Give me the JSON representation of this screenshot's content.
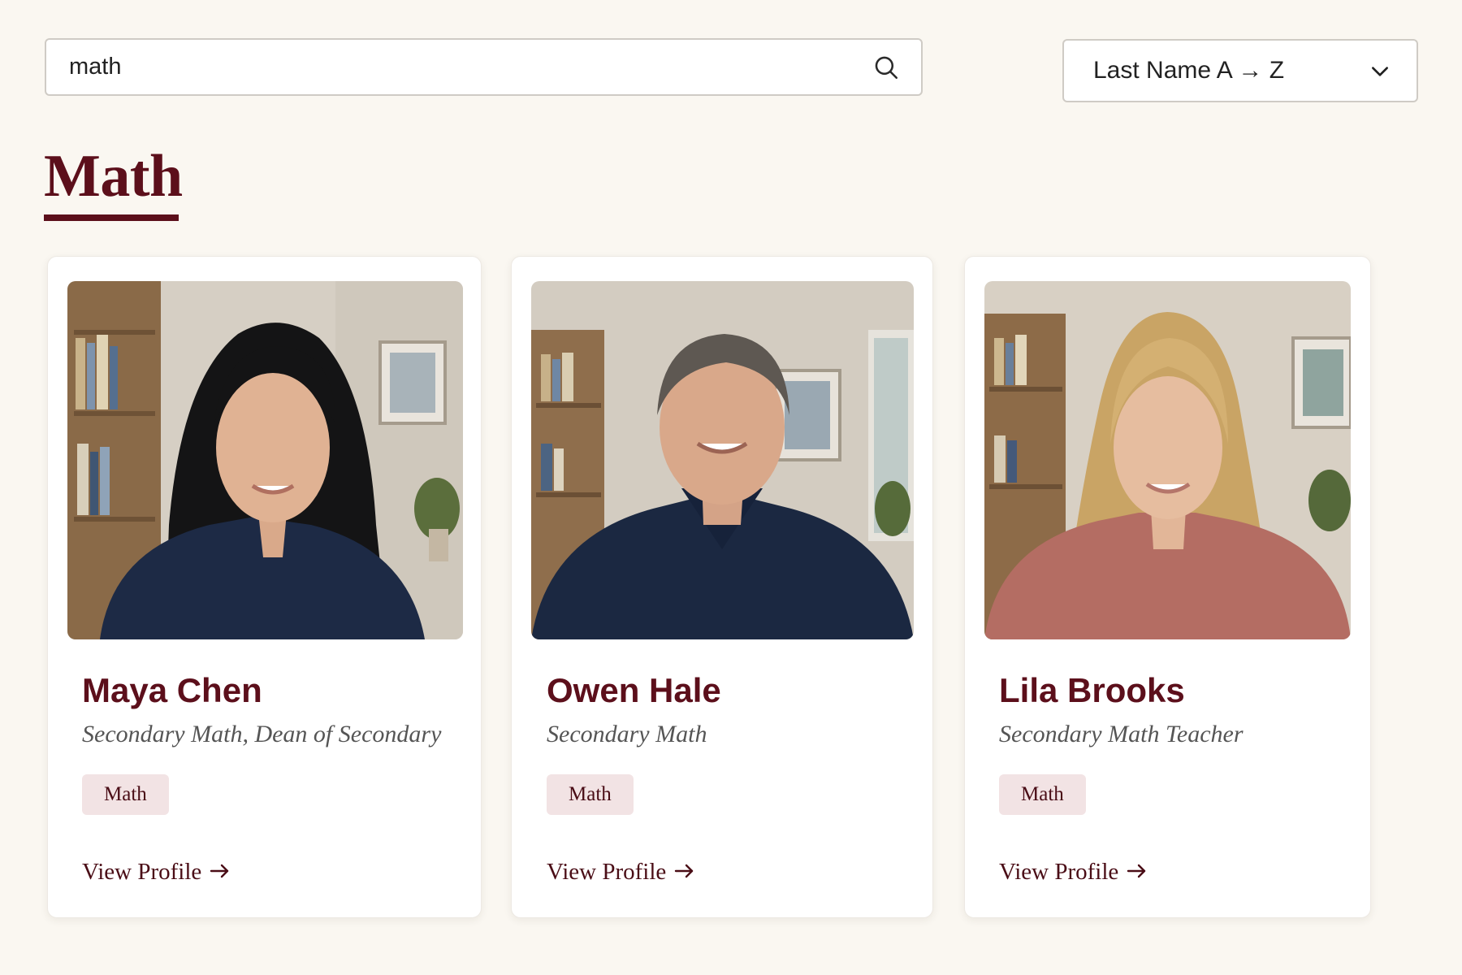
{
  "search": {
    "value": "math",
    "icon": "search-icon"
  },
  "sort": {
    "selected": "Last Name A → Z",
    "icon": "chevron-down-icon"
  },
  "section": {
    "title": "Math"
  },
  "colors": {
    "accent": "#5c0f1b",
    "tag_background": "#f2e3e4",
    "page_background": "#faf7f1"
  },
  "people": [
    {
      "name": "Maya Chen",
      "role": "Secondary Math, Dean of Secondary",
      "tag": "Math",
      "link": "View Profile",
      "link_icon": "arrow-right-icon"
    },
    {
      "name": "Owen Hale",
      "role": "Secondary Math",
      "tag": "Math",
      "link": "View Profile",
      "link_icon": "arrow-right-icon"
    },
    {
      "name": "Lila Brooks",
      "role": "Secondary Math Teacher",
      "tag": "Math",
      "link": "View Profile",
      "link_icon": "arrow-right-icon"
    }
  ]
}
